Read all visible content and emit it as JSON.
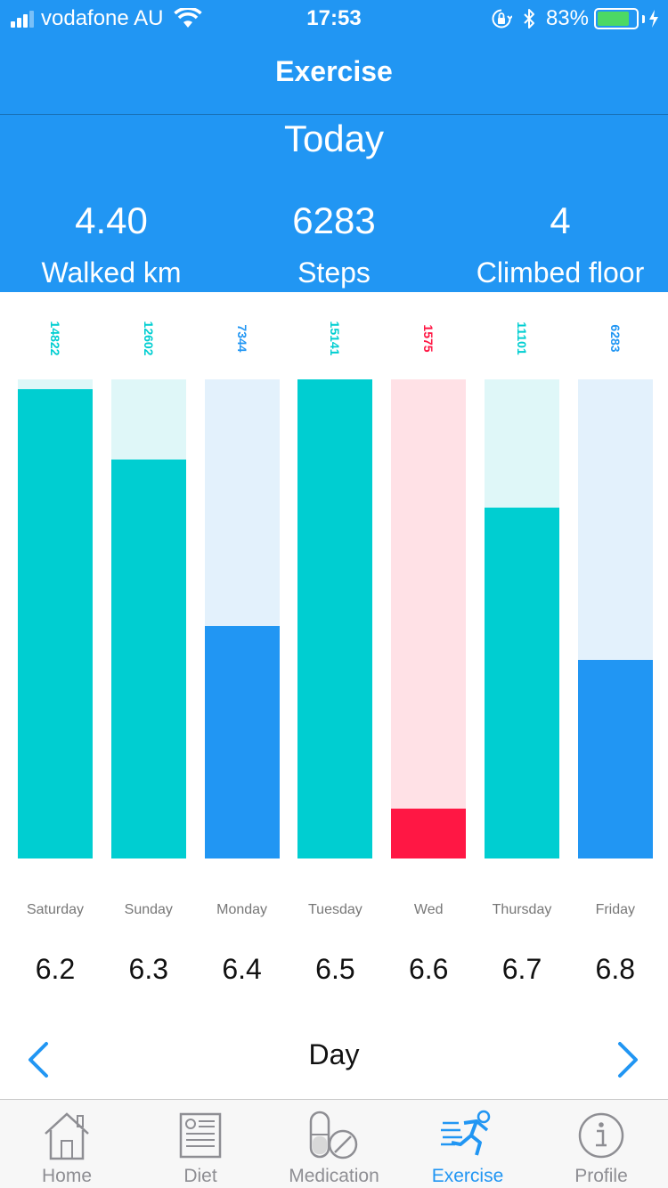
{
  "status_bar": {
    "carrier": "vodafone AU",
    "time": "17:53",
    "battery_percent": "83%",
    "battery_level": 0.83,
    "icons": [
      "signal-icon",
      "wifi-icon",
      "orientation-lock-icon",
      "bluetooth-icon",
      "battery-icon",
      "charging-icon"
    ]
  },
  "nav": {
    "title": "Exercise"
  },
  "summary": {
    "period_title": "Today",
    "stats": [
      {
        "value": "4.40",
        "label": "Walked km"
      },
      {
        "value": "6283",
        "label": "Steps"
      },
      {
        "value": "4",
        "label": "Climbed floor"
      }
    ]
  },
  "colors": {
    "brand_blue": "#2196F3",
    "goal_met": "#00CED1",
    "goal_met_track": "#DFF7F8",
    "partial": "#2196F3",
    "partial_track": "#E3F1FC",
    "low": "#FF1744",
    "low_track": "#FFE1E6"
  },
  "chart_data": {
    "type": "bar",
    "ylim": [
      0,
      15141
    ],
    "bars": [
      {
        "day": "Saturday",
        "value": "14822",
        "steps": 14822,
        "status": "goal_met"
      },
      {
        "day": "Sunday",
        "value": "12602",
        "steps": 12602,
        "status": "goal_met"
      },
      {
        "day": "Monday",
        "value": "7344",
        "steps": 7344,
        "status": "partial"
      },
      {
        "day": "Tuesday",
        "value": "15141",
        "steps": 15141,
        "status": "goal_met"
      },
      {
        "day": "Wed",
        "value": "1575",
        "steps": 1575,
        "status": "low"
      },
      {
        "day": "Thursday",
        "value": "11101",
        "steps": 11101,
        "status": "goal_met"
      },
      {
        "day": "Friday",
        "value": "6283",
        "steps": 6283,
        "status": "partial"
      }
    ]
  },
  "dates": [
    "6.2",
    "6.3",
    "6.4",
    "6.5",
    "6.6",
    "6.7",
    "6.8"
  ],
  "period_nav": {
    "label": "Day",
    "prev_icon": "chevron-left-icon",
    "next_icon": "chevron-right-icon"
  },
  "tabbar": {
    "tabs": [
      {
        "label": "Home",
        "icon": "home-icon"
      },
      {
        "label": "Diet",
        "icon": "diet-icon"
      },
      {
        "label": "Medication",
        "icon": "medication-icon"
      },
      {
        "label": "Exercise",
        "icon": "exercise-icon",
        "active": true
      },
      {
        "label": "Profile",
        "icon": "profile-icon"
      }
    ]
  }
}
